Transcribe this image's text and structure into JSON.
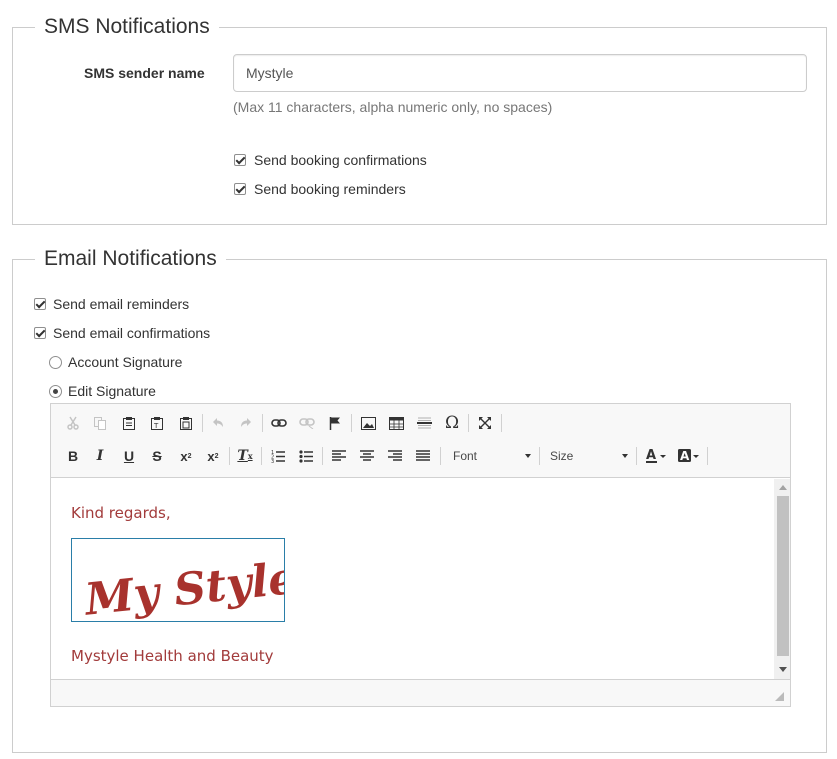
{
  "sms": {
    "legend": "SMS Notifications",
    "sender_label": "SMS sender name",
    "sender_value": "Mystyle",
    "sender_help": "(Max 11 characters, alpha numeric only, no spaces)",
    "checkboxes": [
      {
        "label": "Send booking confirmations",
        "checked": true
      },
      {
        "label": "Send booking reminders",
        "checked": true
      }
    ]
  },
  "email": {
    "legend": "Email Notifications",
    "checkboxes": [
      {
        "label": "Send email reminders",
        "checked": true
      },
      {
        "label": "Send email confirmations",
        "checked": true
      }
    ],
    "signature_options": [
      {
        "label": "Account Signature",
        "selected": false
      },
      {
        "label": "Edit Signature",
        "selected": true
      }
    ]
  },
  "editor": {
    "toolbar_row1": [
      "cut-icon",
      "copy-icon",
      "paste-icon",
      "paste-text-icon",
      "paste-word-icon",
      "undo-icon",
      "redo-icon",
      "link-icon",
      "unlink-icon",
      "anchor-icon",
      "image-icon",
      "table-icon",
      "horizontal-line-icon",
      "special-char-icon",
      "maximize-icon"
    ],
    "toolbar_row2": [
      "bold-icon",
      "italic-icon",
      "underline-icon",
      "strike-icon",
      "subscript-icon",
      "superscript-icon",
      "remove-format-icon",
      "numbered-list-icon",
      "bulleted-list-icon",
      "align-left-icon",
      "align-center-icon",
      "align-right-icon",
      "justify-icon",
      "text-color-icon",
      "bg-color-icon"
    ],
    "font_combo": "Font",
    "size_combo": "Size",
    "content": {
      "greeting": "Kind regards,",
      "logo_text": "My Style",
      "company": "Mystyle Health and Beauty",
      "text_color": "#a23b3b"
    }
  }
}
